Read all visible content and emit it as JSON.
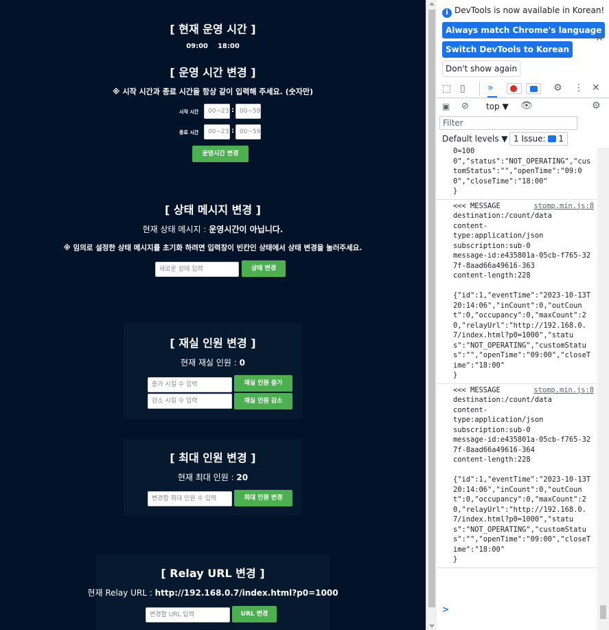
{
  "operating_time": {
    "title": "[ 현재 운영 시간 ]",
    "open": "09:00",
    "close": "18:00",
    "change_title": "[ 운영 시간 변경 ]",
    "note": "※ 시작 시간과 종료 시간을 항상 같이 입력해 주세요. (숫자만)",
    "start_label": "시작 시간",
    "end_label": "종료 시간",
    "hour_placeholder": "00~23",
    "minute_placeholder": "00~59",
    "colon": ":",
    "button": "운영시간 변경"
  },
  "status_message": {
    "title": "[ 상태 메시지 변경 ]",
    "current_label": "현재 상태 메시지 : ",
    "current_value": "운영시간이 아닙니다.",
    "note": "※ 임의로 설정한 상태 메시지를 초기화 하려면 입력창이 빈칸인 상태에서 상태 변경을 눌러주세요.",
    "input_placeholder": "새로운 상태 입력",
    "button": "상태 변경"
  },
  "occupancy": {
    "title": "[ 재실 인원 변경 ]",
    "current_label": "현재 재실 인원 : ",
    "current_value": "0",
    "increase_placeholder": "증가 시킬 수 입력",
    "increase_button": "재실 인원 증가",
    "decrease_placeholder": "감소 시킬 수 입력",
    "decrease_button": "재실 인원 감소"
  },
  "max_count": {
    "title": "[ 최대 인원 변경 ]",
    "current_label": "현재 최대 인원 : ",
    "current_value": "20",
    "input_placeholder": "변경할 최대 인원 수 입력",
    "button": "최대 인원 변경"
  },
  "relay": {
    "title": "[ Relay URL 변경 ]",
    "current_label": "현재 Relay URL : ",
    "current_value": "http://192.168.0.7/index.html?p0=1000",
    "input_placeholder": "변경할 URL 입력",
    "button": "URL 변경"
  },
  "devtools": {
    "banner": "DevTools is now available in Korean!",
    "btn_match": "Always match Chrome's language",
    "btn_switch": "Switch DevTools to Korean",
    "btn_dismiss": "Don't show again",
    "context": "top ▼",
    "filter_placeholder": "Filter",
    "levels": "Default levels ▼",
    "issue": "1 Issue:",
    "issue_count": "1",
    "messages": [
      {
        "header": "",
        "source": "",
        "body": "0=100\n0\",\"status\":\"NOT_OPERATING\",\"customStatus\":\"\",\"openTime\":\"09:00\",\"closeTime\":\"18:00\"\n}"
      },
      {
        "header": "<<< MESSAGE",
        "source": "stomp.min.js:8",
        "body": "destination:/count/data\ncontent-\ntype:application/json\nsubscription:sub-0\nmessage-id:e435801a-05cb-f765-327f-8aad66a49616-363\ncontent-length:228\n\n{\"id\":1,\"eventTime\":\"2023-10-13T20:14:06\",\"inCount\":0,\"outCount\":0,\"occupancy\":0,\"maxCount\":20,\"relayUrl\":\"http://192.168.0.7/index.html?p0=1000\",\"status\":\"NOT_OPERATING\",\"customStatus\":\"\",\"openTime\":\"09:00\",\"closeTime\":\"18:00\"\n}"
      },
      {
        "header": "<<< MESSAGE",
        "source": "stomp.min.js:8",
        "body": "destination:/count/data\ncontent-\ntype:application/json\nsubscription:sub-0\nmessage-id:e435801a-05cb-f765-327f-8aad66a49616-364\ncontent-length:228\n\n{\"id\":1,\"eventTime\":\"2023-10-13T20:14:06\",\"inCount\":0,\"outCount\":0,\"occupancy\":0,\"maxCount\":20,\"relayUrl\":\"http://192.168.0.7/index.html?p0=1000\",\"status\":\"NOT_OPERATING\",\"customStatus\":\"\",\"openTime\":\"09:00\",\"closeTime\":\"18:00\"\n}"
      }
    ],
    "prompt": ">"
  },
  "colors": {
    "app_bg": "#021228",
    "card_bg": "#06192f",
    "button_green": "#4caf50",
    "devtools_blue": "#1a73e8"
  }
}
